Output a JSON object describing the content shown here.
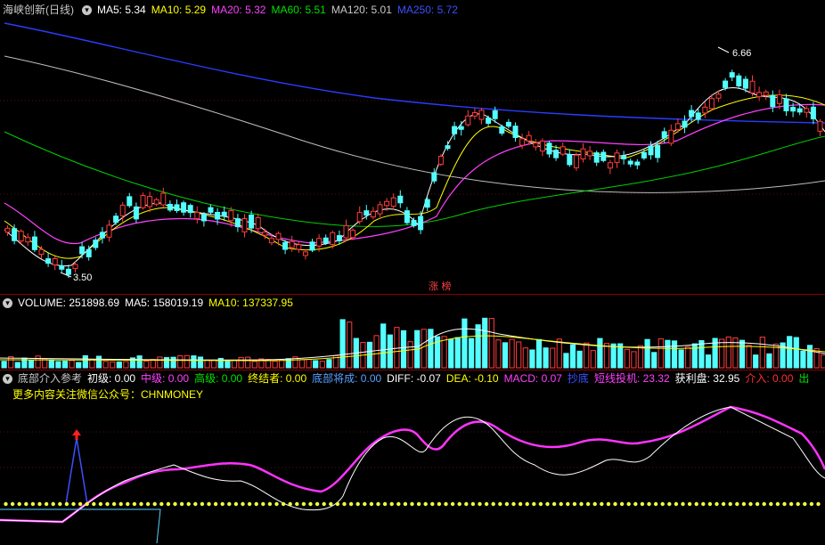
{
  "price_header": {
    "stock": "海峡创新(日线)",
    "ma5": "MA5: 5.34",
    "ma10": "MA10: 5.29",
    "ma20": "MA20: 5.32",
    "ma60": "MA60: 5.51",
    "ma120": "MA120: 5.01",
    "ma250": "MA250: 5.72"
  },
  "price_panel": {
    "high_label": "6.66",
    "low_label": "3.50",
    "limit_badge": "涨 榜"
  },
  "volume_header": {
    "volume": "VOLUME: 251898.69",
    "ma5": "MA5: 158019.19",
    "ma10": "MA10: 137337.95"
  },
  "indicator_header": {
    "name": "底部介入参考",
    "chuji": "初级: 0.00",
    "zhongji": "中级: 0.00",
    "gaoji": "高级: 0.00",
    "zhongjie": "终结者: 0.00",
    "dibu": "底部将成: 0.00",
    "diff": "DIFF: -0.07",
    "dea": "DEA: -0.10",
    "macd": "MACD: 0.07",
    "baodi": "抄底",
    "duanxian": "短线投机: 23.32",
    "huoli": "获利盘: 32.95",
    "jieru": "介入: 0.00",
    "chu": "出"
  },
  "indicator_note": "更多内容关注微信公众号：CHNMONEY",
  "colors": {
    "up": "#ff3c3c",
    "down": "#54ffff",
    "ma5": "#ffffff",
    "ma10": "#ffff00",
    "ma20": "#ff40ff",
    "ma60": "#00e000",
    "ma120": "#c8c8c8",
    "ma250": "#2a3cff",
    "profit": "#ff33ff",
    "duanxian": "#ffffff"
  },
  "icons": {
    "panel_menu": "chevron-down-icon"
  }
}
